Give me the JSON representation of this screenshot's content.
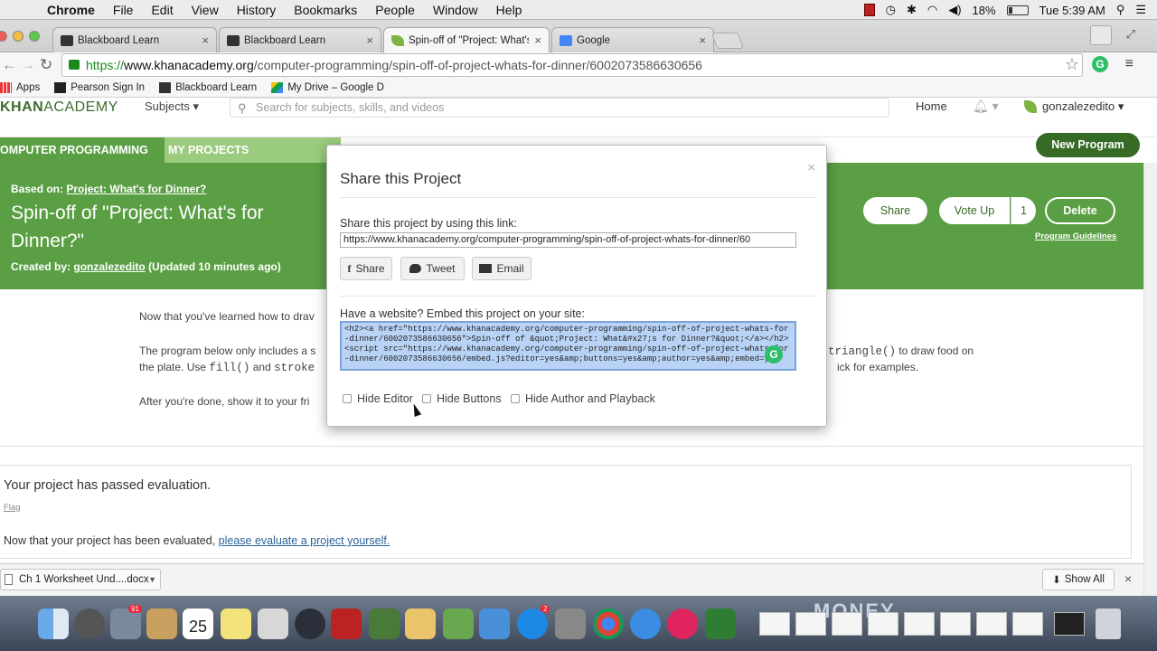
{
  "menubar": {
    "app": "Chrome",
    "items": [
      "File",
      "Edit",
      "View",
      "History",
      "Bookmarks",
      "People",
      "Window",
      "Help"
    ],
    "battery": "18%",
    "clock": "Tue 5:39 AM"
  },
  "tabs": [
    {
      "title": "Blackboard Learn"
    },
    {
      "title": "Blackboard Learn"
    },
    {
      "title": "Spin-off of \"Project: What's"
    },
    {
      "title": "Google"
    }
  ],
  "address": {
    "scheme": "https://",
    "host": "www.khanacademy.org",
    "path": "/computer-programming/spin-off-of-project-whats-for-dinner/6002073586630656"
  },
  "bookmarks": [
    "Apps",
    "Pearson Sign In",
    "Blackboard Learn",
    "My Drive – Google D"
  ],
  "ka_header": {
    "logo_bold": "KHAN",
    "logo_rest": "ACADEMY",
    "subjects": "Subjects ▾",
    "search_placeholder": "Search for subjects, skills, and videos",
    "home": "Home",
    "username": "gonzalezedito ▾"
  },
  "section_tabs": {
    "computer_programming": "OMPUTER PROGRAMMING",
    "my_projects": "MY PROJECTS"
  },
  "new_program": "New Program",
  "project": {
    "based_on_label": "Based on:",
    "based_on_link": "Project: What's for Dinner?",
    "title": "Spin-off of \"Project: What's for Dinner?\"",
    "created_by_label": "Created by:",
    "created_by_user": "gonzalezedito",
    "updated": "(Updated 10 minutes ago)",
    "share": "Share",
    "vote_up": "Vote Up",
    "votes": "1",
    "delete": "Delete",
    "guidelines": "Program Guidelines"
  },
  "description": {
    "line1": "Now that you've learned how to drav",
    "line2a": "The program below only includes a s",
    "line2b_code": "triangle()",
    "line2c": " to draw food on",
    "line3a": "the plate. Use ",
    "line3_fill": "fill()",
    "line3b": " and ",
    "line3_stroke": "stroke",
    "line3c": "ick for examples.",
    "line4": "After you're done, show it to your fri"
  },
  "evaluation": {
    "passed": "Your project has passed evaluation.",
    "flag": "Flag",
    "now_text": "Now that your project has been evaluated, ",
    "now_link": "please evaluate a project yourself."
  },
  "modal": {
    "title": "Share this Project",
    "close": "×",
    "link_label": "Share this project by using this link:",
    "link_value": "https://www.khanacademy.org/computer-programming/spin-off-of-project-whats-for-dinner/60",
    "btn_facebook": "Share",
    "btn_twitter": "Tweet",
    "btn_email": "Email",
    "embed_label": "Have a website? Embed this project on your site:",
    "embed_code": "<h2><a href=\"https://www.khanacademy.org/computer-programming/spin-off-of-project-whats-for-dinner/6002073586630656\">Spin-off of &quot;Project: What&#x27;s for Dinner?&quot;</a></h2> <script src=\"https://www.khanacademy.org/computer-programming/spin-off-of-project-whats-for-dinner/6002073586630656/embed.js?editor=yes&amp;buttons=yes&amp;author=yes&amp;embed=yes\"",
    "hide_editor": "Hide Editor",
    "hide_buttons": "Hide Buttons",
    "hide_author": "Hide Author and Playback"
  },
  "download": {
    "file": "Ch 1 Worksheet Und....docx",
    "show_all": "Show All"
  },
  "dock": {
    "calendar_day": "25",
    "badge_mail": "91",
    "badge_appstore": "2",
    "mony_text": "MONEY"
  },
  "colors": {
    "ka_green": "#5a9f44",
    "ka_light_green": "#9bcb7e",
    "ka_dark_green": "#356b24"
  }
}
